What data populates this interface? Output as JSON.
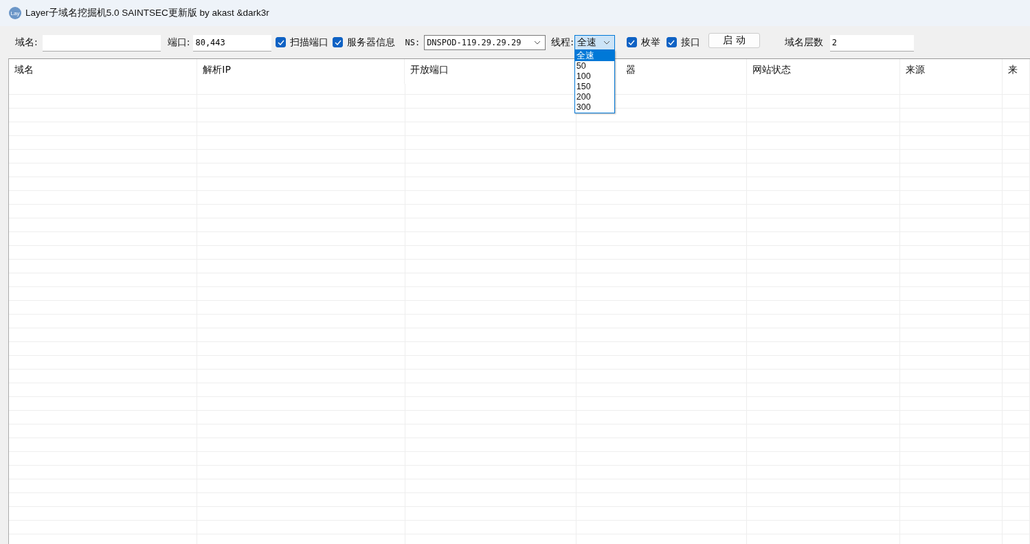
{
  "window": {
    "title": "Layer子域名挖掘机5.0 SAINTSEC更新版 by akast &dark3r",
    "icon_text": "Lay"
  },
  "toolbar": {
    "domain": {
      "label": "域名:"
    },
    "port": {
      "label": "端口:",
      "value": "80,443"
    },
    "checks": [
      {
        "label": "扫描端口",
        "checked": true
      },
      {
        "label": "服务器信息",
        "checked": true
      }
    ],
    "dns": {
      "label": "NS:",
      "value": "DNSPOD-119.29.29.29"
    },
    "threads": {
      "label": "线程:",
      "value": "全速",
      "expanded": true,
      "options": [
        {
          "label": "全速",
          "selected": true
        },
        {
          "label": "50",
          "selected": false
        },
        {
          "label": "100",
          "selected": false
        },
        {
          "label": "150",
          "selected": false
        },
        {
          "label": "200",
          "selected": false
        },
        {
          "label": "300",
          "selected": false
        }
      ]
    },
    "checks2": [
      {
        "label": "枚举",
        "checked": true
      },
      {
        "label": "接口",
        "checked": true
      }
    ],
    "start_button": "启 动",
    "depth": {
      "label": "域名层数",
      "value": "2"
    }
  },
  "table": {
    "columns": [
      "域名",
      "解析IP",
      "开放端口",
      "器",
      "网站状态",
      "来源",
      "来"
    ]
  }
}
